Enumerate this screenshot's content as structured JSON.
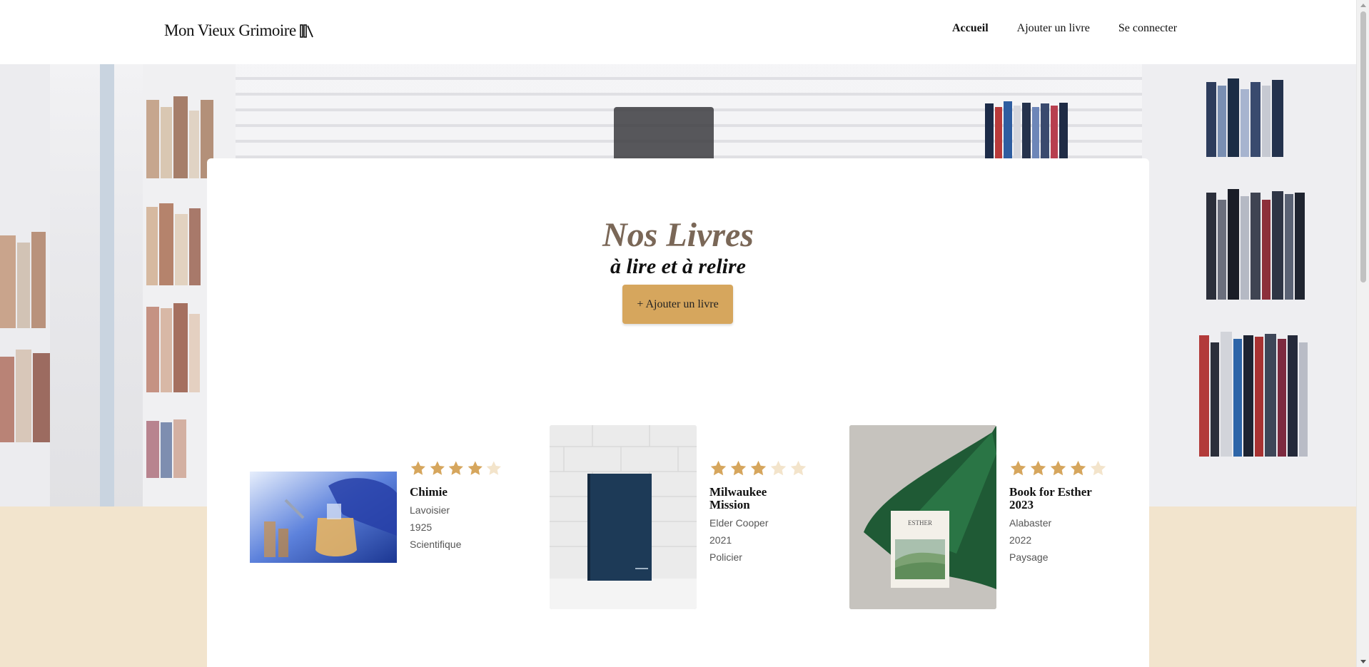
{
  "brand": {
    "logo_text": "Mon Vieux Grimoire",
    "logo_icon": "books-icon"
  },
  "nav": {
    "items": [
      {
        "label": "Accueil",
        "active": true
      },
      {
        "label": "Ajouter un livre",
        "active": false
      },
      {
        "label": "Se connecter",
        "active": false
      }
    ]
  },
  "hero": {
    "title": "Nos Livres",
    "subtitle": "à lire et à relire",
    "add_button": "+ Ajouter un livre"
  },
  "colors": {
    "accent": "#d6a65d",
    "title": "#7a6757",
    "beige": "#f2e4cd",
    "star_filled": "#d6a65d",
    "star_empty": "#f3e4cb"
  },
  "books": [
    {
      "title": "Chimie",
      "author": "Lavoisier",
      "year": "1925",
      "genre": "Scientifique",
      "rating": 4,
      "max_rating": 5
    },
    {
      "title": "Milwaukee Mission",
      "author": "Elder Cooper",
      "year": "2021",
      "genre": "Policier",
      "rating": 3,
      "max_rating": 5
    },
    {
      "title": "Book for Esther 2023",
      "author": "Alabaster",
      "year": "2022",
      "genre": "Paysage",
      "rating": 4,
      "max_rating": 5,
      "cover_text": "ESTHER"
    }
  ]
}
